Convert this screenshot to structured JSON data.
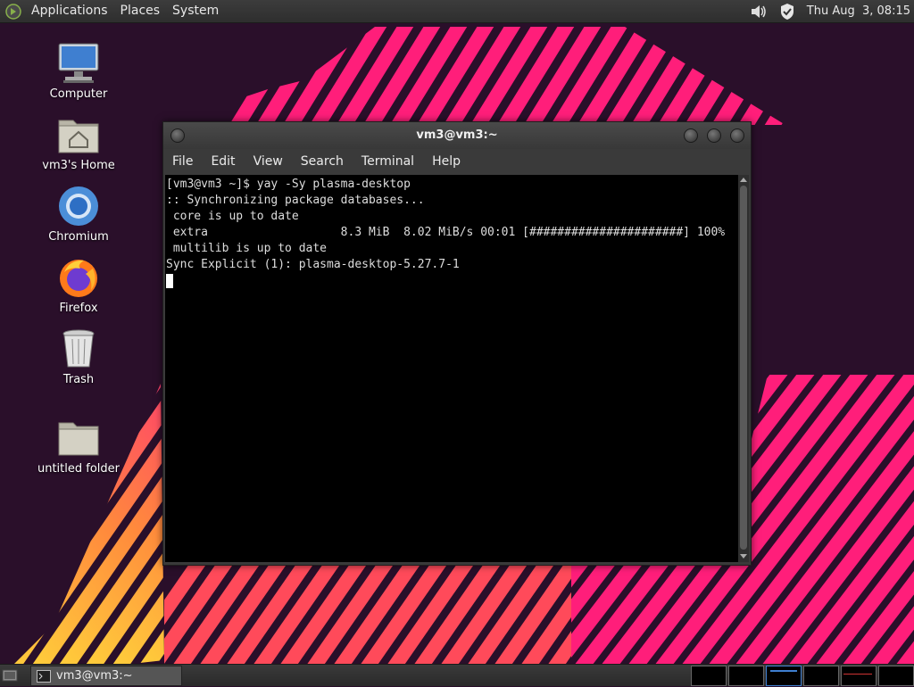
{
  "colors": {
    "wallpaper_bg": "#2a0f2a",
    "stripe_pink": "#ff1e7a",
    "stripe_orange": "#ff8a3c"
  },
  "top_panel": {
    "menus": [
      "Applications",
      "Places",
      "System"
    ],
    "tray_icons": [
      "volume-icon",
      "shield-icon"
    ],
    "clock": "Thu Aug  3, 08:15"
  },
  "desktop": {
    "icons": [
      {
        "label": "Computer",
        "icon": "computer-icon"
      },
      {
        "label": "vm3's Home",
        "icon": "home-folder-icon"
      },
      {
        "label": "Chromium",
        "icon": "chromium-icon"
      },
      {
        "label": "Firefox",
        "icon": "firefox-icon"
      },
      {
        "label": "Trash",
        "icon": "trash-icon"
      },
      {
        "label": "untitled folder",
        "icon": "folder-icon"
      }
    ]
  },
  "terminal": {
    "title": "vm3@vm3:~",
    "menu": [
      "File",
      "Edit",
      "View",
      "Search",
      "Terminal",
      "Help"
    ],
    "lines": [
      "[vm3@vm3 ~]$ yay -Sy plasma-desktop",
      ":: Synchronizing package databases...",
      " core is up to date",
      " extra                   8.3 MiB  8.02 MiB/s 00:01 [######################] 100%",
      " multilib is up to date",
      "Sync Explicit (1): plasma-desktop-5.27.7-1"
    ]
  },
  "taskbar": {
    "task_label": "vm3@vm3:~",
    "workspaces": 6
  }
}
